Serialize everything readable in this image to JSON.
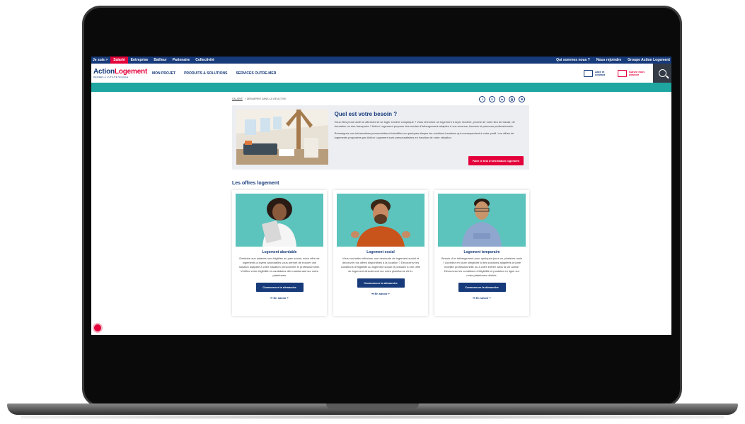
{
  "topbar": {
    "prefix": "Je suis >",
    "segments": [
      "Salarié",
      "Entreprise",
      "Bailleur",
      "Partenaire",
      "Collectivité"
    ],
    "active_index": 0,
    "right_links": [
      "Qui sommes nous ?",
      "Nous rejoindre",
      "Groupe Action Logement"
    ]
  },
  "header": {
    "logo_part1": "Action",
    "logo_part2": "Logement",
    "logo_sub": "DÉDIÉES À L'UTILITÉ SOCIALE",
    "nav": [
      "MON PROJET",
      "PRODUITS & SOLUTIONS",
      "SERVICES OUTRE-MER"
    ],
    "aide": "Aide et contact",
    "suivre": "Suivre mon dossier"
  },
  "breadcrumb": {
    "root": "SALARIÉ",
    "separator": ">",
    "current": "DÉMARRER DANS LA VIE ACTIVE"
  },
  "shares": [
    "f",
    "X",
    "in",
    "⎙",
    "✉"
  ],
  "besoin": {
    "title": "Quel est votre besoin ?",
    "p1": "Vous êtes jeune actif ou alternant et se loger s'avère compliqué ? Vous cherchez un logement à loyer modéré, proche de votre lieu de travail, de formation ou des transports ? Action Logement propose des modes d'hébergement adaptés à vos revenus, besoins et parcours professionnels.",
    "p2": "Renseignez vos informations personnelles et identifiez en quelques étapes les solutions locatives qui correspondent à votre profil. Les offres de logements proposées par Action Logement sont personnalisées en fonction de votre situation.",
    "button": "Faire le test d'orientation logement"
  },
  "offres": {
    "title": "Les offres logement",
    "cards": [
      {
        "title": "Logement abordable",
        "desc": "Destinée aux salariés non éligibles au parc social, notre offre de logements à loyers abordables vous permet de trouver une solution adaptée à votre situation personnelle et professionnelle. Vérifiez votre éligibilité et candidatez dès maintenant sur notre plateforme",
        "button": "Commencer la démarche",
        "more": "➡ En savoir +"
      },
      {
        "title": "Logement social",
        "desc": "Vous souhaitez effectuer une demande de logement social et découvrir nos offres disponibles à la location ? Découvrez les conditions d'éligibilité au logement social et postulez à une offre de logement directement sur notre plateforme AL'in.",
        "button": "Commencer la démarche",
        "more": "➡ En savoir +"
      },
      {
        "title": "Logement temporaire",
        "desc": "Besoin d'un hébergement pour quelques jours ou plusieurs mois ? Accédez en toute simplicité à des solutions adaptées à votre mobilité professionnelle ou à votre entrée dans la vie active. Découvrez les conditions d'éligibilité et postulez en ligne sur notre plateforme dédiée.",
        "button": "Commencer la démarche",
        "more": "➡ En savoir +"
      }
    ]
  },
  "colors": {
    "navy": "#163a7a",
    "red": "#e4003a",
    "teal": "#1fa6a0",
    "card_bg": "#5cc3bd"
  }
}
